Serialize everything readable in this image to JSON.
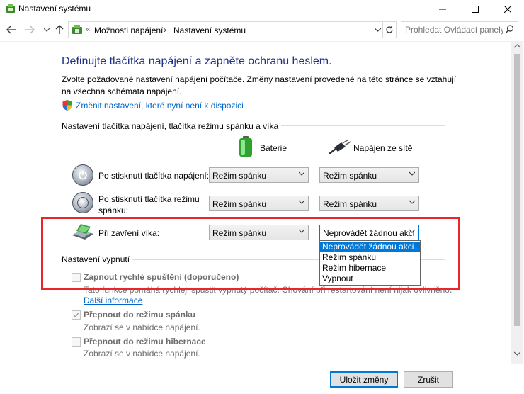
{
  "window": {
    "title": "Nastavení systému"
  },
  "nav": {
    "breadcrumb": [
      "Možnosti napájení",
      "Nastavení systému"
    ],
    "guillemet": "«",
    "search_placeholder": "Prohledat Ovládací panely"
  },
  "main": {
    "heading": "Definujte tlačítka napájení a zapněte ochranu heslem.",
    "description": "Zvolte požadované nastavení napájení počítače. Změny nastavení provedené na této stránce se vztahují na všechna schémata napájení.",
    "change_link": "Změnit nastavení, které nyní není k dispozici",
    "buttons_group_title": "Nastavení tlačítka napájení, tlačítka režimu spánku a víka",
    "col_battery": "Baterie",
    "col_plugged": "Napájen ze sítě",
    "rows": [
      {
        "label": "Po stisknutí tlačítka napájení:",
        "battery": "Režim spánku",
        "plugged": "Režim spánku"
      },
      {
        "label": "Po stisknutí tlačítka režimu spánku:",
        "battery": "Režim spánku",
        "plugged": "Režim spánku"
      },
      {
        "label": "Při zavření víka:",
        "battery": "Režim spánku",
        "plugged": "Neprovádět žádnou akci"
      }
    ],
    "dropdown_options": [
      "Neprovádět žádnou akci",
      "Režim spánku",
      "Režim hibernace",
      "Vypnout"
    ],
    "shutdown_group_title": "Nastavení vypnutí",
    "fast_startup": {
      "label": "Zapnout rychlé spuštění (doporučeno)",
      "desc": "Tato funkce pomáhá rychleji spustit vypnutý počítač. Chování při restartování není nijak ovlivněno.",
      "more": "Další informace"
    },
    "sleep_option": {
      "label": "Přepnout do režimu spánku",
      "desc": "Zobrazí se v nabídce napájení."
    },
    "hibernate_option": {
      "label": "Přepnout do režimu hibernace",
      "desc": "Zobrazí se v nabídce napájení."
    }
  },
  "footer": {
    "save": "Uložit změny",
    "cancel": "Zrušit"
  },
  "colors": {
    "accent": "#0078d7",
    "heading": "#1e3287",
    "link": "#0066cc",
    "highlight_box": "#e8262b"
  }
}
